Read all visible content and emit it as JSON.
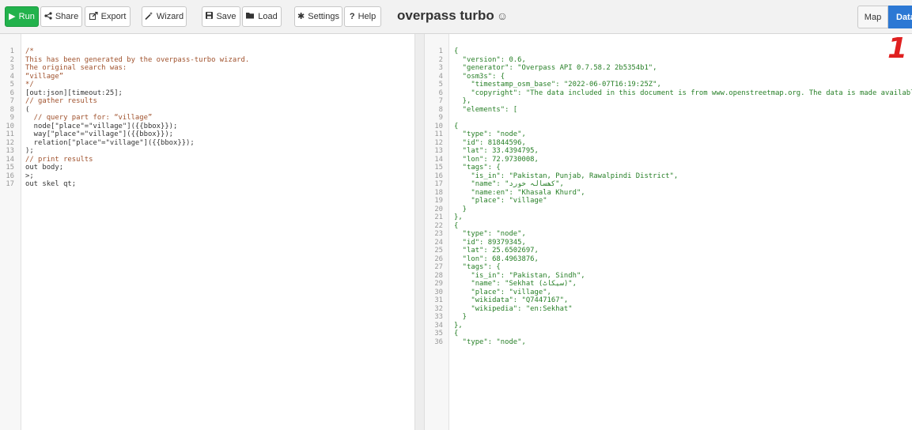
{
  "toolbar": {
    "run": "Run",
    "share": "Share",
    "export": "Export",
    "wizard": "Wizard",
    "save": "Save",
    "load": "Load",
    "settings": "Settings",
    "help": "Help",
    "title": "overpass turbo",
    "map_tab": "Map",
    "data_tab": "Data"
  },
  "annotation": "1",
  "icons": {
    "run": "play-icon",
    "share": "share-icon",
    "export": "export-icon",
    "wizard": "wand-icon",
    "save": "floppy-icon",
    "load": "folder-icon",
    "settings": "gear-icon",
    "help": "question-icon",
    "title": "github-icon"
  },
  "colors": {
    "run": "#22b24c",
    "data_tab": "#2c78d4",
    "annotation": "#e02020"
  },
  "query_lines": [
    "/*",
    "This has been generated by the overpass-turbo wizard.",
    "The original search was:",
    "“village”",
    "*/",
    "[out:json][timeout:25];",
    "// gather results",
    "(",
    "  // query part for: “village”",
    "  node[\"place\"=\"village\"]({{bbox}});",
    "  way[\"place\"=\"village\"]({{bbox}});",
    "  relation[\"place\"=\"village\"]({{bbox}});",
    ");",
    "// print results",
    "out body;",
    ">;",
    "out skel qt;"
  ],
  "data_lines": [
    "{",
    "  \"version\": 0.6,",
    "  \"generator\": \"Overpass API 0.7.58.2 2b5354b1\",",
    "  \"osm3s\": {",
    "    \"timestamp_osm_base\": \"2022-06-07T16:19:25Z\",",
    "    \"copyright\": \"The data included in this document is from www.openstreetmap.org. The data is made availabl",
    "  },",
    "  \"elements\": [",
    "",
    "{",
    "  \"type\": \"node\",",
    "  \"id\": 81844596,",
    "  \"lat\": 33.4394795,",
    "  \"lon\": 72.9730008,",
    "  \"tags\": {",
    "    \"is_in\": \"Pakistan, Punjab, Rawalpindi District\",",
    "    \"name\": \"کھسالہ خورد\",",
    "    \"name:en\": \"Khasala Khurd\",",
    "    \"place\": \"village\"",
    "  }",
    "},",
    "{",
    "  \"type\": \"node\",",
    "  \"id\": 89379345,",
    "  \"lat\": 25.6502697,",
    "  \"lon\": 68.4963876,",
    "  \"tags\": {",
    "    \"is_in\": \"Pakistan, Sindh\",",
    "    \"name\": \"Sekhat (سیکاٹ)\",",
    "    \"place\": \"village\",",
    "    \"wikidata\": \"Q7447167\",",
    "    \"wikipedia\": \"en:Sekhat\"",
    "  }",
    "},",
    "{",
    "  \"type\": \"node\","
  ]
}
